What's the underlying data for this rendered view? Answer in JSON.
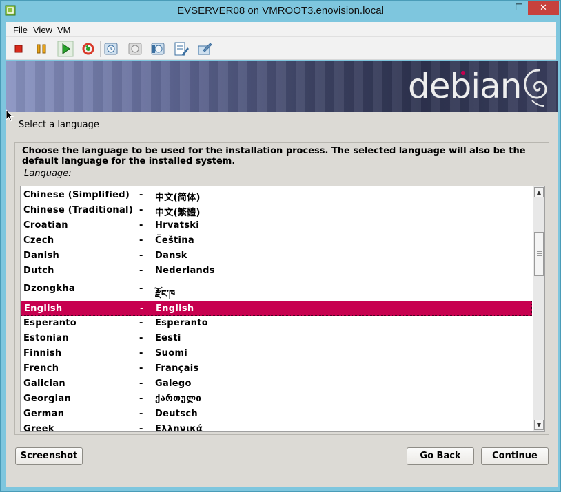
{
  "window": {
    "title": "EVSERVER08 on VMROOT3.enovision.local",
    "min_glyph": "—",
    "max_glyph": "☐",
    "close_glyph": "✕"
  },
  "menu": {
    "items": [
      "File",
      "View",
      "VM"
    ]
  },
  "toolbar": {
    "buttons": [
      "stop-icon",
      "pause-icon",
      "play-icon",
      "reset-icon",
      "snapshot-icon",
      "revert-snapshot-icon",
      "manage-snapshots-icon",
      "edit-settings-icon",
      "console-settings-icon"
    ],
    "colors": {
      "stop": "#d92a1c",
      "pause": "#e8a317",
      "play": "#27a32a",
      "reset": "#d93a2a"
    }
  },
  "banner": {
    "logo_text": "debian",
    "accent": "#c7004f"
  },
  "installer": {
    "heading": "Select a language",
    "description": "Choose the language to be used for the installation process. The selected language will also be the default language for the installed system.",
    "list_label": "Language:",
    "languages": [
      {
        "name": "Chinese (Simplified)",
        "sep": "-",
        "native": "中文(简体)"
      },
      {
        "name": "Chinese (Traditional)",
        "sep": "-",
        "native": "中文(繁體)"
      },
      {
        "name": "Croatian",
        "sep": "-",
        "native": "Hrvatski"
      },
      {
        "name": "Czech",
        "sep": "-",
        "native": "Čeština"
      },
      {
        "name": "Danish",
        "sep": "-",
        "native": "Dansk"
      },
      {
        "name": "Dutch",
        "sep": "-",
        "native": "Nederlands"
      },
      {
        "name": "Dzongkha",
        "sep": "-",
        "native": "རྫོང་ཁ"
      },
      {
        "name": "English",
        "sep": "-",
        "native": "English"
      },
      {
        "name": "Esperanto",
        "sep": "-",
        "native": "Esperanto"
      },
      {
        "name": "Estonian",
        "sep": "-",
        "native": "Eesti"
      },
      {
        "name": "Finnish",
        "sep": "-",
        "native": "Suomi"
      },
      {
        "name": "French",
        "sep": "-",
        "native": "Français"
      },
      {
        "name": "Galician",
        "sep": "-",
        "native": "Galego"
      },
      {
        "name": "Georgian",
        "sep": "-",
        "native": "ქართული"
      },
      {
        "name": "German",
        "sep": "-",
        "native": "Deutsch"
      },
      {
        "name": "Greek",
        "sep": "-",
        "native": "Ελληνικά"
      }
    ],
    "selected_language": "English",
    "selection_color": "#c7004f",
    "buttons": {
      "screenshot": "Screenshot",
      "go_back": "Go Back",
      "continue": "Continue"
    }
  }
}
